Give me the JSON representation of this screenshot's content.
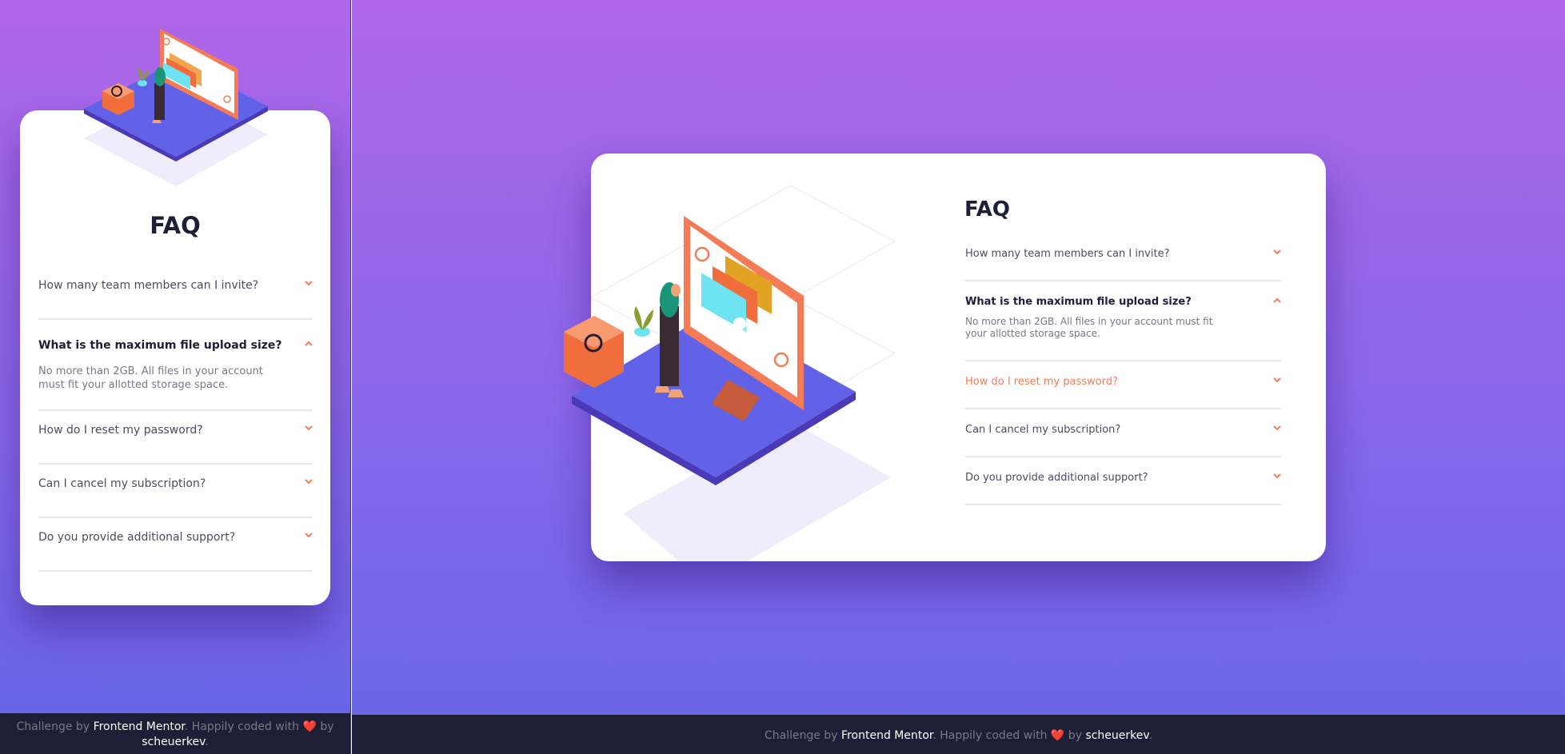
{
  "title": "FAQ",
  "faq": [
    {
      "question": "How many team members can I invite?",
      "answer": "",
      "open": false
    },
    {
      "question": "What is the maximum file upload size?",
      "answer": "No more than 2GB. All files in your account must fit your allotted storage space.",
      "open": true
    },
    {
      "question": "How do I reset my password?",
      "answer": "",
      "open": false
    },
    {
      "question": "Can I cancel my subscription?",
      "answer": "",
      "open": false
    },
    {
      "question": "Do you provide additional support?",
      "answer": "",
      "open": false
    }
  ],
  "footer": {
    "prefix": "Challenge by ",
    "brand": "Frontend Mentor",
    "middle": ". Happily coded with ",
    "heart": "❤️",
    "by": " by ",
    "author": "scheuerkev",
    "suffix": "."
  },
  "colors": {
    "accent": "#f47b56",
    "title": "#1e1f36",
    "text": "#4b4c5f",
    "footer_bg": "#1e1f36"
  },
  "icons": {
    "chevron_down": "chevron-down-icon",
    "chevron_up": "chevron-up-icon"
  }
}
